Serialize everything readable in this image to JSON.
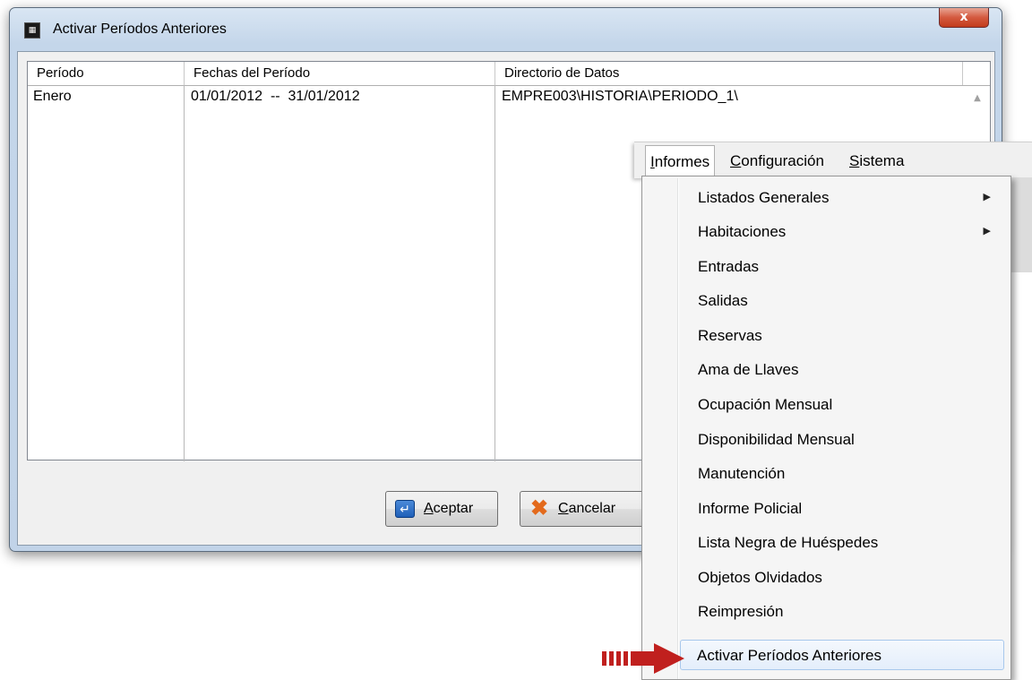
{
  "window": {
    "title": "Activar Períodos Anteriores",
    "close_label": "x"
  },
  "list": {
    "headers": [
      "Período",
      "Fechas del Período",
      "Directorio de Datos"
    ],
    "rows": [
      {
        "periodo": "Enero",
        "fechas": "01/01/2012  --  31/01/2012",
        "directorio": "EMPRE003\\HISTORIA\\PERIODO_1\\"
      }
    ]
  },
  "buttons": {
    "ok_label": "Aceptar",
    "cancel_label": "Cancelar"
  },
  "menubar": {
    "items": [
      "Informes",
      "Configuración",
      "Sistema"
    ]
  },
  "menu": {
    "items": [
      {
        "label": "Listados Generales",
        "submenu": true
      },
      {
        "label": "Habitaciones",
        "submenu": true
      },
      {
        "label": "Entradas"
      },
      {
        "label": "Salidas"
      },
      {
        "label": "Reservas"
      },
      {
        "label": "Ama de Llaves"
      },
      {
        "label": "Ocupación Mensual"
      },
      {
        "label": "Disponibilidad Mensual"
      },
      {
        "label": "Manutención"
      },
      {
        "label": "Informe Policial"
      },
      {
        "label": "Lista Negra de Huéspedes"
      },
      {
        "label": "Objetos Olvidados"
      },
      {
        "label": "Reimpresión"
      },
      {
        "label": "Activar Períodos Anteriores",
        "highlighted": true
      }
    ]
  },
  "colors": {
    "arrow": "#c0201e",
    "highlight_border": "#a8c8ec"
  },
  "icons": {
    "app": "app-icon",
    "ok": "enter-icon",
    "cancel": "x-icon",
    "submenu": "triangle-right-icon",
    "pointer": "red-arrow-icon"
  }
}
